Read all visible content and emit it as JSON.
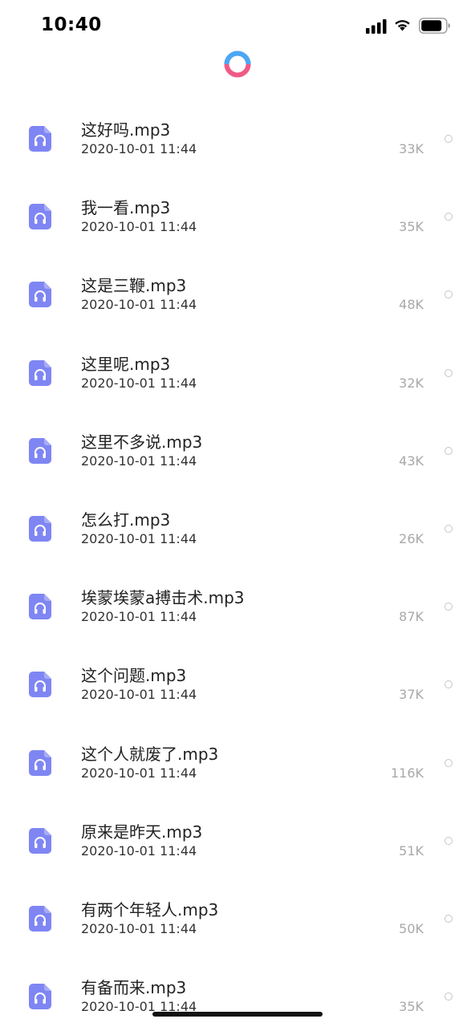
{
  "status_bar": {
    "time": "10:40",
    "signal_icon": "cellular-signal-icon",
    "wifi_icon": "wifi-icon",
    "battery_icon": "battery-icon"
  },
  "loading": {
    "icon": "loading-spinner-icon",
    "colors": [
      "#49a8f5",
      "#f05a87"
    ]
  },
  "file_icon": {
    "name": "audio-file-icon",
    "color": "#7f86f3"
  },
  "files": [
    {
      "name": "这好吗.mp3",
      "date": "2020-10-01 11:44",
      "size": "33K"
    },
    {
      "name": "我一看.mp3",
      "date": "2020-10-01 11:44",
      "size": "35K"
    },
    {
      "name": "这是三鞭.mp3",
      "date": "2020-10-01 11:44",
      "size": "48K"
    },
    {
      "name": "这里呢.mp3",
      "date": "2020-10-01 11:44",
      "size": "32K"
    },
    {
      "name": "这里不多说.mp3",
      "date": "2020-10-01 11:44",
      "size": "43K"
    },
    {
      "name": "怎么打.mp3",
      "date": "2020-10-01 11:44",
      "size": "26K"
    },
    {
      "name": "埃蒙埃蒙a搏击术.mp3",
      "date": "2020-10-01 11:44",
      "size": "87K"
    },
    {
      "name": "这个问题.mp3",
      "date": "2020-10-01 11:44",
      "size": "37K"
    },
    {
      "name": "这个人就废了.mp3",
      "date": "2020-10-01 11:44",
      "size": "116K"
    },
    {
      "name": "原来是昨天.mp3",
      "date": "2020-10-01 11:44",
      "size": "51K"
    },
    {
      "name": "有两个年轻人.mp3",
      "date": "2020-10-01 11:44",
      "size": "50K"
    },
    {
      "name": "有备而来.mp3",
      "date": "2020-10-01 11:44",
      "size": "35K"
    }
  ]
}
